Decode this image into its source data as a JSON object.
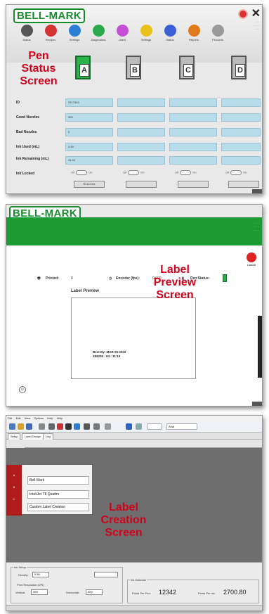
{
  "brand": "BELL-MARK",
  "pen_screen": {
    "caption": [
      "Pen",
      "Status",
      "Screen"
    ],
    "nav": [
      "Status",
      "Recipes",
      "Settings",
      "Diagnostics",
      "Users",
      "Settings",
      "Status",
      "Reports",
      "Products"
    ],
    "nav_colors": [
      "#555555",
      "#d33333",
      "#2a7fd4",
      "#2aa84a",
      "#c24fd4",
      "#e8c21a",
      "#3b5fd6",
      "#e07a1a",
      "#999999"
    ],
    "pens": [
      "A",
      "B",
      "C",
      "D"
    ],
    "rows": [
      "ID",
      "Good Nozzles",
      "Bad Nozzles",
      "Ink Used (mL)",
      "Ink Remaining (mL)",
      "Ink Locked"
    ],
    "pen_a_values": [
      "2517349",
      "300",
      "0",
      "3.59",
      "41.00"
    ],
    "toggle_off": "Off",
    "toggle_on": "On",
    "reset_label": "Reset Ink"
  },
  "label_screen": {
    "caption": [
      "Label",
      "Preview",
      "Screen"
    ],
    "cancel": "Cancel",
    "printed_label": "Printed:",
    "printed_value": "0",
    "encoder_label": "Encoder (fps):",
    "encoder_value": "0.000",
    "pen_status_label": "Pen Status:",
    "preview_title": "Label Preview",
    "preview_line1": "Best By: MAR 05 2022",
    "preview_line2": "284205 : 04 : 11:13"
  },
  "creation_screen": {
    "caption": [
      "Label",
      "Creation",
      "Screen"
    ],
    "menu": [
      "File",
      "Edit",
      "View",
      "Options",
      "Help",
      "Help"
    ],
    "font_name": "Arial",
    "tabs": [
      "Setup",
      "Label Design",
      "Log"
    ],
    "fields": [
      "Bell-Mark",
      "InteliJet T8 Quattro",
      "Custom Label Creation"
    ],
    "ink_group": "Ink Setup",
    "density_label": "Density:",
    "density_value": "0.50",
    "print_res_label": "Print Resolution (DPI)",
    "vertical_label": "Vertical:",
    "vertical_value": "300",
    "horizontal_label": "Horizontal:",
    "horizontal_value": "300",
    "ink_estimate_group": "Ink Estimate",
    "prints_label": "Prints Per Pen:",
    "prints_value": "12342",
    "prints_per_ml_label": "Prints Per mL:",
    "prints_per_ml_value": "2700.80"
  }
}
